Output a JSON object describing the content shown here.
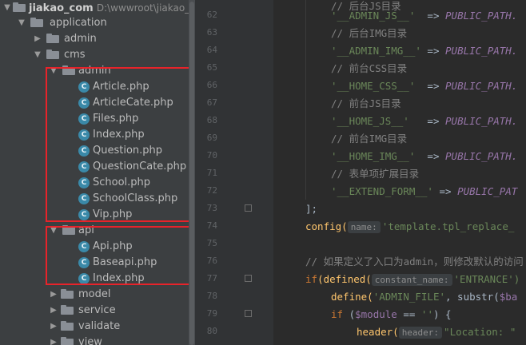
{
  "tree": {
    "root": {
      "label": "jiakao_com",
      "path": "D:\\wwwroot\\jiakao_co"
    },
    "items": [
      {
        "label": "application"
      },
      {
        "label": "admin"
      },
      {
        "label": "cms"
      },
      {
        "label": "admin"
      },
      {
        "label": "Article.php"
      },
      {
        "label": "ArticleCate.php"
      },
      {
        "label": "Files.php"
      },
      {
        "label": "Index.php"
      },
      {
        "label": "Question.php"
      },
      {
        "label": "QuestionCate.php"
      },
      {
        "label": "School.php"
      },
      {
        "label": "SchoolClass.php"
      },
      {
        "label": "Vip.php"
      },
      {
        "label": "api"
      },
      {
        "label": "Api.php"
      },
      {
        "label": "Baseapi.php"
      },
      {
        "label": "Index.php"
      },
      {
        "label": "model"
      },
      {
        "label": "service"
      },
      {
        "label": "validate"
      },
      {
        "label": "view"
      }
    ]
  },
  "editor": {
    "line_numbers": [
      "62",
      "63",
      "64",
      "65",
      "66",
      "67",
      "68",
      "69",
      "70",
      "71",
      "72",
      "73",
      "74",
      "75",
      "76",
      "77",
      "78",
      "79",
      "80"
    ],
    "lines": [
      {
        "text": "// 后台JS目录"
      },
      {
        "key": "'__ADMIN_JS__'",
        "arrow": "=>",
        "value": "PUBLIC_PATH."
      },
      {
        "text": "// 后台IMG目录"
      },
      {
        "key": "'__ADMIN_IMG__'",
        "arrow": "=>",
        "value": "PUBLIC_PATH."
      },
      {
        "text": "// 前台CSS目录"
      },
      {
        "key": "'__HOME_CSS__'",
        "arrow": "=>",
        "value": "PUBLIC_PATH."
      },
      {
        "text": "// 前台JS目录"
      },
      {
        "key": "'__HOME_JS__'",
        "arrow": "=>",
        "value": "PUBLIC_PATH."
      },
      {
        "text": "// 前台IMG目录"
      },
      {
        "key": "'__HOME_IMG__'",
        "arrow": "=>",
        "value": "PUBLIC_PATH."
      },
      {
        "text": "// 表单项扩展目录"
      },
      {
        "key": "'__EXTEND_FORM__'",
        "arrow": "=>",
        "value": "PUBLIC_PAT"
      },
      {
        "text": "];"
      },
      {
        "fn": "config(",
        "hint": "name:",
        "str": "'template.tpl_replace_"
      },
      {
        "text": ""
      },
      {
        "text": "// 如果定义了入口为admin，则修改默认的访问"
      },
      {
        "kw": "if",
        "fn": "(defined(",
        "hint": "constant_name:",
        "str": "'ENTRANCE')"
      },
      {
        "fn": "define(",
        "str": "'ADMIN_FILE'",
        "rest": ", substr(",
        "var": "$ba"
      },
      {
        "kw": "if",
        "rest": " (",
        "var": "$module",
        "rest2": " == ",
        "str": "''",
        "rest3": ") {"
      },
      {
        "fn": "header(",
        "hint": "header:",
        "str": "\"Location: \""
      }
    ]
  }
}
